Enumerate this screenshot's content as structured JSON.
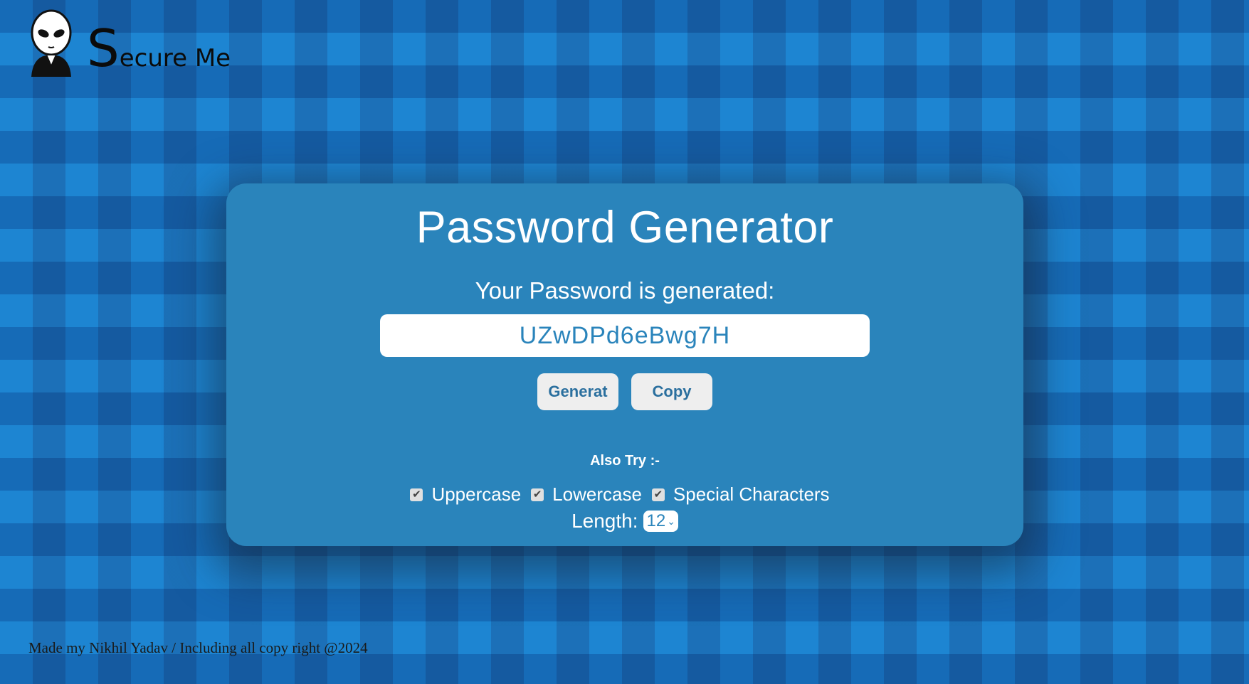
{
  "brand": {
    "initial": "S",
    "rest": "ecure Me",
    "icon": "alien-icon"
  },
  "card": {
    "title": "Password Generator",
    "subtitle": "Your Password is generated:",
    "password": "UZwDPd6eBwg7H",
    "generate_label": "Generat",
    "copy_label": "Copy",
    "also_try": "Also Try :-",
    "options": [
      {
        "label": "Uppercase",
        "checked": true
      },
      {
        "label": "Lowercase",
        "checked": true
      },
      {
        "label": "Special Characters",
        "checked": true
      }
    ],
    "length_label": "Length:",
    "length_value": "12"
  },
  "footer": {
    "text": "Made my Nikhil Yadav / Including all copy right @2024"
  },
  "colors": {
    "card": "#2a84bb",
    "accent": "#2a84bb"
  }
}
